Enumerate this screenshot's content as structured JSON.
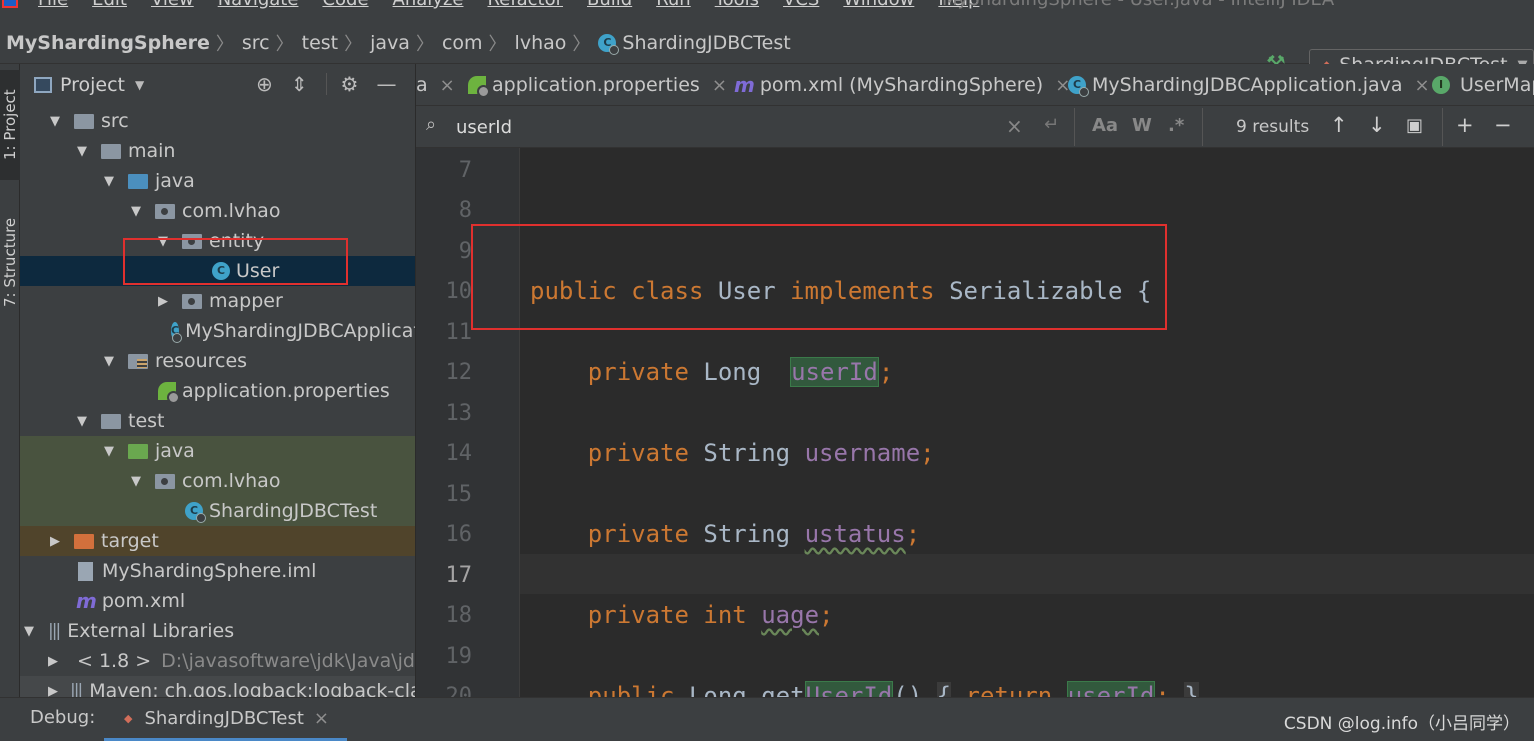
{
  "menubar": {
    "items": [
      "File",
      "Edit",
      "View",
      "Navigate",
      "Code",
      "Analyze",
      "Refactor",
      "Build",
      "Run",
      "Tools",
      "VCS",
      "Window",
      "Help"
    ],
    "window_title": "MyShardingSphere - User.java - IntelliJ IDEA"
  },
  "breadcrumb": [
    "MyShardingSphere",
    "src",
    "test",
    "java",
    "com",
    "lvhao",
    "ShardingJDBCTest"
  ],
  "run_config": {
    "label": "ShardingJDBCTest"
  },
  "left_strip": {
    "project_tab": "1: Project",
    "structure_tab": "7: Structure"
  },
  "project_panel": {
    "title": "Project"
  },
  "tree": [
    {
      "label": "src",
      "icon": "folder"
    },
    {
      "label": "main",
      "icon": "folder"
    },
    {
      "label": "java",
      "icon": "folder-blue"
    },
    {
      "label": "com.lvhao",
      "icon": "package"
    },
    {
      "label": "entity",
      "icon": "package"
    },
    {
      "label": "User",
      "icon": "class-icon"
    },
    {
      "label": "mapper",
      "icon": "package"
    },
    {
      "label": "MyShardingJDBCApplication",
      "icon": "class-icon"
    },
    {
      "label": "resources",
      "icon": "resources-folder"
    },
    {
      "label": "application.properties",
      "icon": "spring-icon"
    },
    {
      "label": "test",
      "icon": "folder"
    },
    {
      "label": "java",
      "icon": "folder-green"
    },
    {
      "label": "com.lvhao",
      "icon": "package"
    },
    {
      "label": "ShardingJDBCTest",
      "icon": "class-icon"
    },
    {
      "label": "target",
      "icon": "folder-orange"
    },
    {
      "label": "MyShardingSphere.iml",
      "icon": "file-icon"
    },
    {
      "label": "pom.xml",
      "icon": "maven-icon"
    },
    {
      "label": "External Libraries",
      "icon": "library-icon"
    },
    {
      "label": "< 1.8 >",
      "detail": "D:\\javasoftware\\jdk\\Java\\jdk",
      "icon": "folder"
    },
    {
      "label": "Maven: ch.qos.logback:logback-classic",
      "icon": "library-icon"
    }
  ],
  "editor_tabs": [
    {
      "label": "a"
    },
    {
      "label": "application.properties"
    },
    {
      "label": "pom.xml (MyShardingSphere)"
    },
    {
      "label": "MyShardingJDBCApplication.java"
    },
    {
      "label": "UserMap"
    }
  ],
  "search": {
    "query": "userId",
    "results": "9 results",
    "match_case": "Aa",
    "words": "W",
    "regex": ".*"
  },
  "line_numbers": [
    "7",
    "8",
    "9",
    "10",
    "11",
    "12",
    "13",
    "14",
    "15",
    "16",
    "17",
    "18",
    "19",
    "20"
  ],
  "current_line": "17",
  "code": {
    "l10": {
      "public": "public",
      "class": "class",
      "name": "User",
      "implements": "implements",
      "iface": "Serializable",
      "brace": "{"
    },
    "l12": {
      "mod": "private",
      "type": "Long",
      "field": "userId",
      "end": ";"
    },
    "l14": {
      "mod": "private",
      "type": "String",
      "field": "username",
      "end": ";"
    },
    "l16": {
      "mod": "private",
      "type": "String",
      "field": "ustatus",
      "end": ";"
    },
    "l18": {
      "mod": "private",
      "type": "int",
      "field": "uage",
      "end": ";"
    },
    "l20": {
      "mod": "public",
      "type": "Long",
      "method": "get",
      "method_hl": "UserId",
      "paren": "()",
      "brace": "{",
      "ret": "return",
      "field": "userId",
      "end": ";",
      "close": "}"
    }
  },
  "debug": {
    "label": "Debug:",
    "tab": "ShardingJDBCTest"
  },
  "watermark": "CSDN @log.info（小吕同学）",
  "colors": {
    "keyword": "#cc7832",
    "field": "#9876aa",
    "text": "#a9b7c6",
    "selection": "#0d293e",
    "annotation_box": "#e0302e"
  }
}
